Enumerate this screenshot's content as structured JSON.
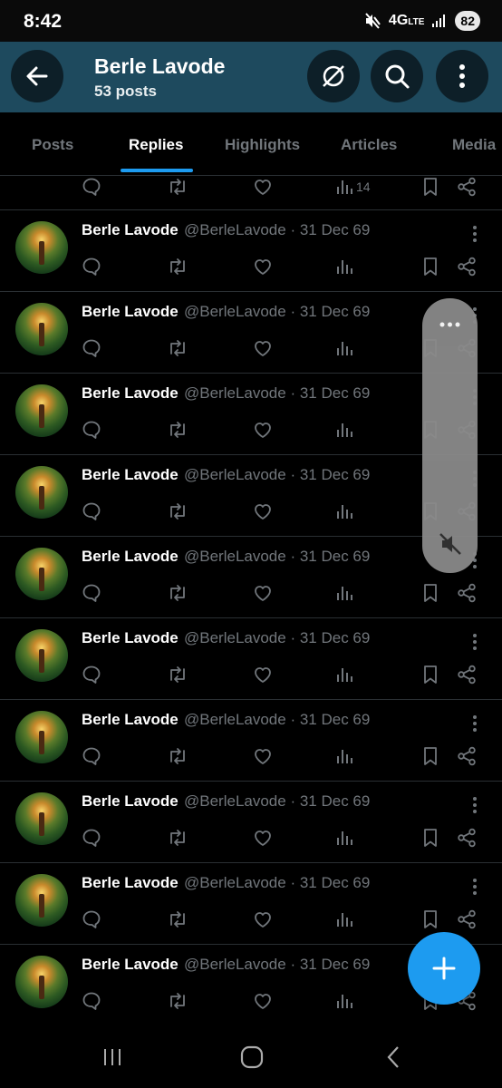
{
  "status_bar": {
    "time": "8:42",
    "network": "4G",
    "network_sub": "LTE",
    "battery": "82"
  },
  "header": {
    "title": "Berle Lavode",
    "subtitle": "53 posts"
  },
  "tabs": [
    {
      "label": "Posts",
      "active": false
    },
    {
      "label": "Replies",
      "active": true
    },
    {
      "label": "Highlights",
      "active": false
    },
    {
      "label": "Articles",
      "active": false
    },
    {
      "label": "Media",
      "active": false
    }
  ],
  "top_partial_post": {
    "views": "14"
  },
  "posts": [
    {
      "name": "Berle Lavode",
      "handle": "@BerleLavode",
      "date": "31 Dec 69"
    },
    {
      "name": "Berle Lavode",
      "handle": "@BerleLavode",
      "date": "31 Dec 69"
    },
    {
      "name": "Berle Lavode",
      "handle": "@BerleLavode",
      "date": "31 Dec 69"
    },
    {
      "name": "Berle Lavode",
      "handle": "@BerleLavode",
      "date": "31 Dec 69"
    },
    {
      "name": "Berle Lavode",
      "handle": "@BerleLavode",
      "date": "31 Dec 69"
    },
    {
      "name": "Berle Lavode",
      "handle": "@BerleLavode",
      "date": "31 Dec 69"
    },
    {
      "name": "Berle Lavode",
      "handle": "@BerleLavode",
      "date": "31 Dec 69"
    },
    {
      "name": "Berle Lavode",
      "handle": "@BerleLavode",
      "date": "31 Dec 69"
    },
    {
      "name": "Berle Lavode",
      "handle": "@BerleLavode",
      "date": "31 Dec 69"
    },
    {
      "name": "Berle Lavode",
      "handle": "@BerleLavode",
      "date": "31 Dec 69"
    }
  ],
  "colors": {
    "accent": "#1d9bf0",
    "header_bg": "#1e4a5e",
    "muted": "#71767b"
  },
  "icons": [
    "back-arrow-icon",
    "grok-icon",
    "search-icon",
    "more-vertical-icon",
    "reply-icon",
    "repost-icon",
    "like-icon",
    "views-icon",
    "bookmark-icon",
    "share-icon",
    "compose-plus-icon",
    "mute-icon"
  ]
}
